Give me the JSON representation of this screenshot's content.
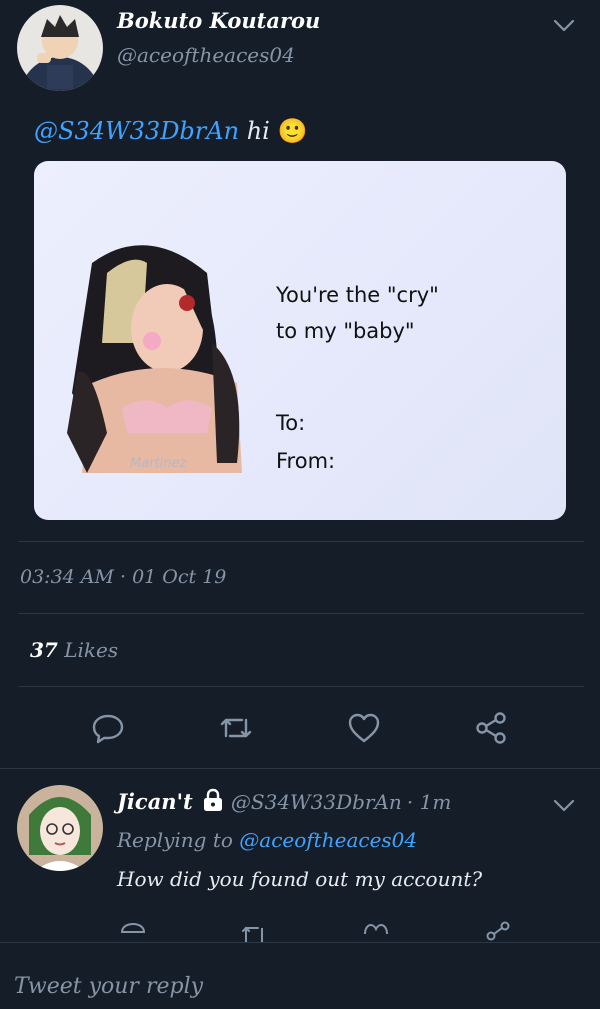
{
  "tweet": {
    "author_name": "Bokuto Koutarou",
    "author_handle": "@aceoftheaces04",
    "mention": "@S34W33DbrAn",
    "text": "hi",
    "emoji": "🙂",
    "image": {
      "line1": "You're the \"cry\"",
      "line2": "to my \"baby\"",
      "to_label": "To:",
      "from_label": "From:",
      "watermark": "Martinez"
    },
    "timestamp": "03:34 AM · 01 Oct 19",
    "likes_count": "37",
    "likes_label": "Likes"
  },
  "reply": {
    "author_name": "Jican't",
    "author_handle": "@S34W33DbrAn",
    "time": "· 1m",
    "replying_prefix": "Replying to",
    "replying_to": "@aceoftheaces04",
    "text": "How did you found out my account?"
  },
  "composer": {
    "placeholder": "Tweet your reply"
  },
  "colors": {
    "background": "#151d28",
    "accent": "#3fa3ff",
    "muted": "#8595a6",
    "divider": "#2b3745"
  },
  "icons": [
    "reply-icon",
    "retweet-icon",
    "like-icon",
    "share-icon",
    "chevron-down-icon",
    "lock-icon"
  ]
}
